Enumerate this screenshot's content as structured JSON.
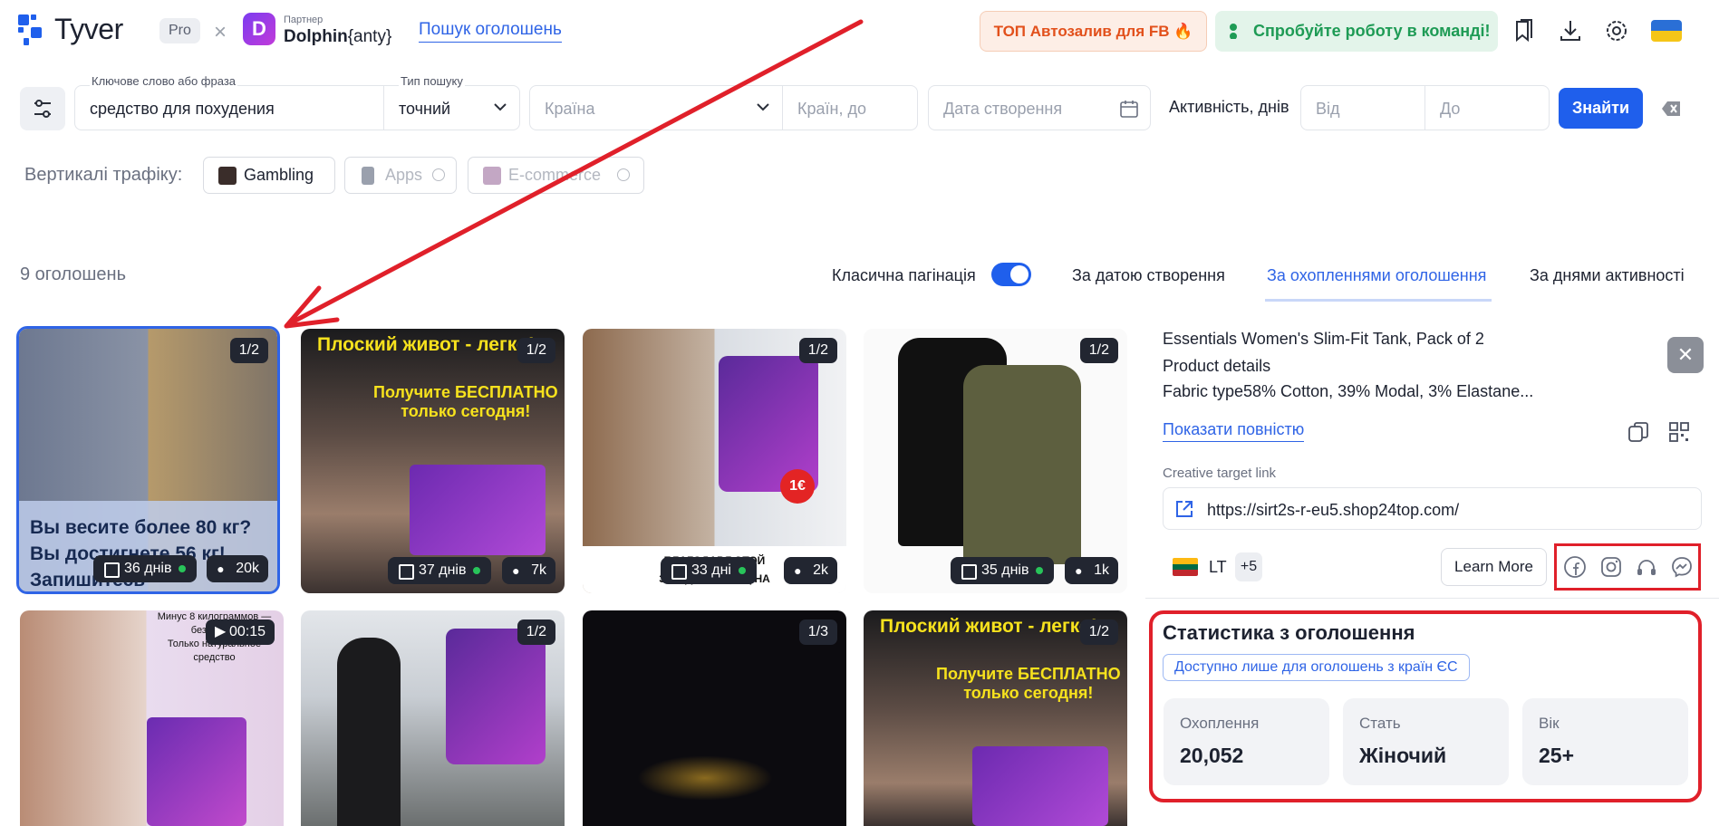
{
  "header": {
    "logo_text": "Tyver",
    "plan_badge": "Pro",
    "times_sign": "×",
    "partner_label": "Партнер",
    "partner_name": "Dolphin",
    "partner_suffix": "{anty}",
    "search_link": "Пошук оголошень",
    "top_button": "ТОП Автозалив для FB 🔥",
    "team_button": "Спробуйте роботу в команді!"
  },
  "filters": {
    "keyword_label": "Ключове слово або фраза",
    "keyword_value": "средство для похудения",
    "search_type_label": "Тип пошуку",
    "search_type_value": "точний",
    "country_placeholder": "Країна",
    "countries_to_placeholder": "Країн, до",
    "date_placeholder": "Дата створення",
    "activity_label": "Активність, днів",
    "from_placeholder": "Від",
    "to_placeholder": "До",
    "find_button": "Знайти"
  },
  "verticals": {
    "label": "Вертикалі трафіку:",
    "chips": [
      "Gambling",
      "Apps",
      "E-commerce"
    ]
  },
  "results": {
    "count": "9 оголошень",
    "pagination_label": "Класична пагінація",
    "sort_options": [
      "За датою створення",
      "За охопленнями оголошення",
      "За днями активності"
    ]
  },
  "cards": [
    {
      "badge": "1/2",
      "days": "36 днів",
      "views": "20k",
      "overlay": [
        "Вы весите более 80 кг?",
        "Вы достигнете 56 кг!",
        "Запишитесь"
      ]
    },
    {
      "badge": "1/2",
      "days": "37 днів",
      "views": "7k",
      "overlay": [
        "Плоский живот - легко!",
        "Получите БЕСПЛАТНО",
        "только сегодня!"
      ]
    },
    {
      "badge": "1/2",
      "days": "33 дні",
      "views": "2k",
      "overlay": [
        "БЛАГОДАРЯ ЭТОЙ",
        "ЗА ОДИН МЕСЯЦ НА"
      ]
    },
    {
      "badge": "1/2",
      "days": "35 днів",
      "views": "1k",
      "overlay": []
    },
    {
      "badge": "00:15",
      "overlay": [
        "Минус 8 килограммов —",
        "без диеты",
        "Только натуральное",
        "средство"
      ]
    },
    {
      "badge": "1/2",
      "overlay": []
    },
    {
      "badge": "1/3",
      "overlay": []
    },
    {
      "badge": "1/2",
      "overlay": [
        "Плоский живот - легко!",
        "Получите БЕСПЛАТНО",
        "только сегодня!"
      ]
    }
  ],
  "panel": {
    "title": "Essentials Women's Slim-Fit Tank, Pack of 2",
    "line2": "Product details",
    "line3": "Fabric type58% Cotton, 39% Modal, 3% Elastane...",
    "show_full": "Показати повністю",
    "target_label": "Creative target link",
    "target_url": "https://sirt2s-r-eu5.shop24top.com/",
    "country": "LT",
    "more_countries": "+5",
    "cta": "Learn More",
    "stats_title": "Статистика з оголошення",
    "eu_note": "Доступно лише для оголошень з країн ЄС",
    "stats": [
      {
        "label": "Охоплення",
        "value": "20,052"
      },
      {
        "label": "Стать",
        "value": "Жіночий"
      },
      {
        "label": "Вік",
        "value": "25+"
      }
    ]
  },
  "colors": {
    "accent": "#1f5fec",
    "annotation_red": "#e0202a",
    "success_green": "#1e9b55",
    "orange": "#e2501b"
  },
  "icons": [
    "bookmarks-icon",
    "download-icon",
    "gear-icon",
    "ukraine-flag-icon",
    "filter-sliders-icon",
    "chevron-down-icon",
    "calendar-icon",
    "clear-icon",
    "close-icon",
    "copy-icon",
    "qr-icon",
    "external-link-icon",
    "facebook-icon",
    "instagram-icon",
    "audience-network-icon",
    "messenger-icon"
  ]
}
